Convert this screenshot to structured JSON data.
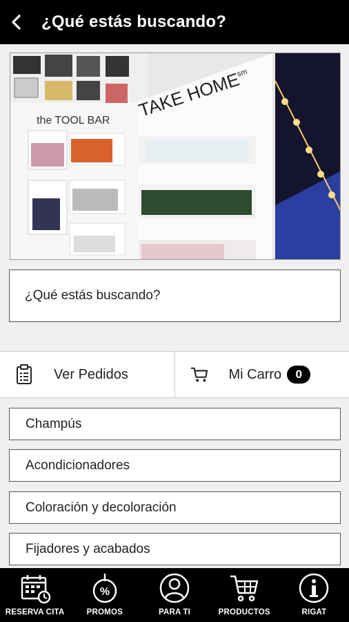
{
  "header": {
    "title": "¿Qué estás buscando?"
  },
  "hero": {
    "sign_left": "the TOOL BAR",
    "sign_right": "TAKE HOME",
    "sign_right_sup": "sm"
  },
  "search": {
    "placeholder": "¿Qué estás buscando?"
  },
  "actions": {
    "orders_label": "Ver Pedidos",
    "cart_label": "Mi Carro",
    "cart_count": "0"
  },
  "categories": [
    {
      "label": "Champús"
    },
    {
      "label": "Acondicionadores"
    },
    {
      "label": "Coloración y decoloración"
    },
    {
      "label": "Fijadores y acabados"
    }
  ],
  "bottom_nav": [
    {
      "label": "RESERVA CITA",
      "icon": "calendar-icon"
    },
    {
      "label": "PROMOS",
      "icon": "percent-tag-icon"
    },
    {
      "label": "PARA TI",
      "icon": "user-icon"
    },
    {
      "label": "PRODUCTOS",
      "icon": "cart-icon"
    },
    {
      "label": "RIGAT",
      "icon": "info-icon"
    }
  ]
}
